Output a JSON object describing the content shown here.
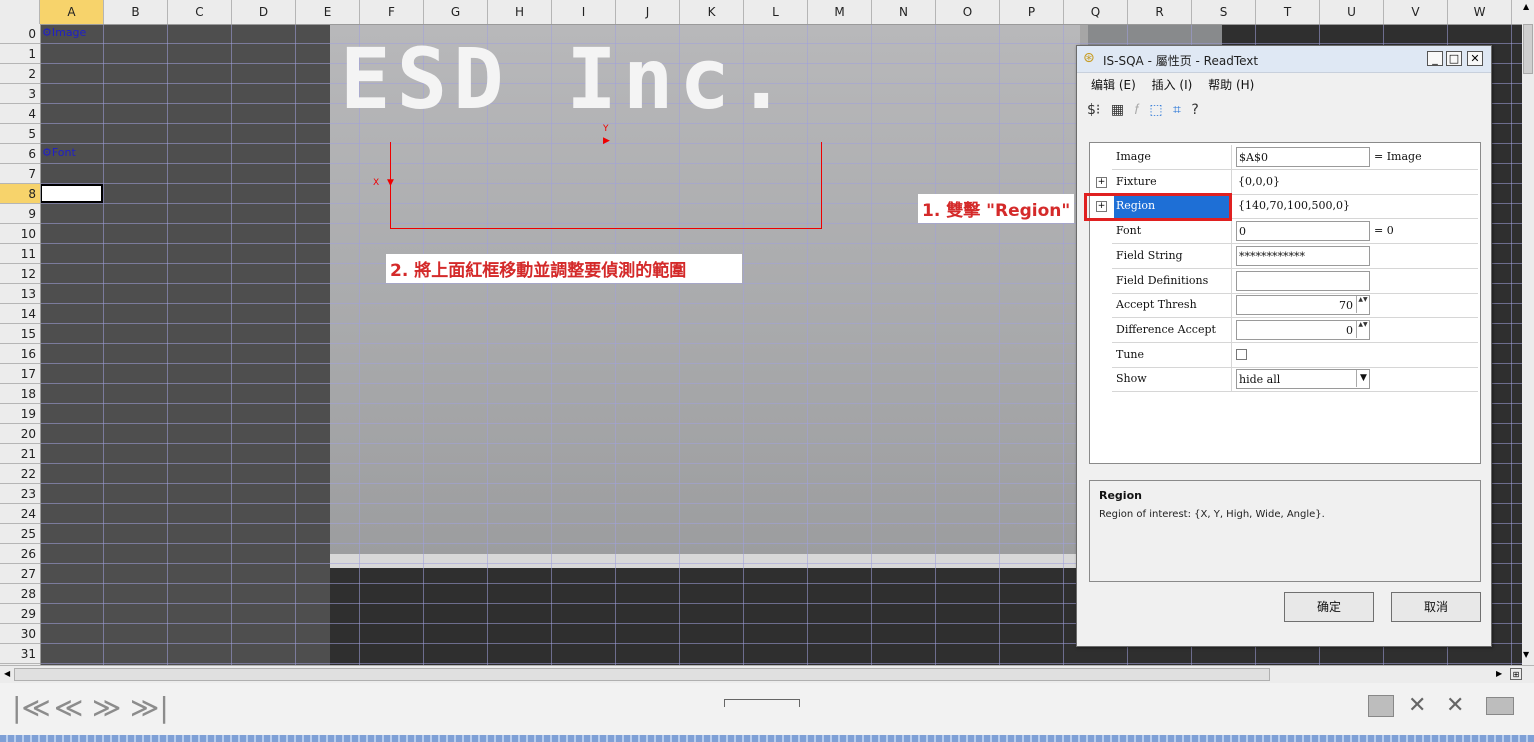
{
  "columns": [
    "A",
    "B",
    "C",
    "D",
    "E",
    "F",
    "G",
    "H",
    "I",
    "J",
    "K",
    "L",
    "M",
    "N",
    "O",
    "P",
    "Q",
    "R",
    "S",
    "T",
    "U",
    "V",
    "W"
  ],
  "rows": [
    "0",
    "1",
    "2",
    "3",
    "4",
    "5",
    "6",
    "7",
    "8",
    "9",
    "10",
    "11",
    "12",
    "13",
    "14",
    "15",
    "16",
    "17",
    "18",
    "19",
    "20",
    "21",
    "22",
    "23",
    "24",
    "25",
    "26",
    "27",
    "28",
    "29",
    "30",
    "31"
  ],
  "selected_column": "A",
  "selected_row": "8",
  "cells": {
    "image_cell": "⚙Image",
    "font_cell": "⚙Font"
  },
  "image": {
    "logo_text": "ESD Inc."
  },
  "roi_labels": {
    "x": "X",
    "y": "Y"
  },
  "callouts": {
    "step1": "1. 雙擊 \"Region\"",
    "step2": "2. 將上面紅框移動並調整要偵測的範圍"
  },
  "dialog": {
    "title": "IS-SQA - 屬性页 - ReadText",
    "menu": [
      "编辑 (E)",
      "插入 (I)",
      "帮助 (H)"
    ],
    "properties": [
      {
        "name": "Image",
        "value": "$A$0",
        "extra": "= Image"
      },
      {
        "name": "Fixture",
        "value": "{0,0,0}",
        "extra": ""
      },
      {
        "name": "Region",
        "value": "{140,70,100,500,0}",
        "extra": ""
      },
      {
        "name": "Font",
        "value": "0",
        "extra": "= 0"
      },
      {
        "name": "Field String",
        "value": "************",
        "extra": ""
      },
      {
        "name": "Field Definitions",
        "value": "",
        "extra": ""
      },
      {
        "name": "Accept Thresh",
        "value": "70",
        "extra": ""
      },
      {
        "name": "Difference Accept",
        "value": "0",
        "extra": ""
      },
      {
        "name": "Tune",
        "value": "",
        "extra": ""
      },
      {
        "name": "Show",
        "value": "hide all",
        "extra": ""
      }
    ],
    "description_title": "Region",
    "description_text": "Region of interest: {X, Y, High, Wide, Angle}.",
    "ok_label": "确定",
    "cancel_label": "取消"
  },
  "nav": {
    "first": "|≪",
    "prev": "≪",
    "next": "≫",
    "last": "≫|"
  }
}
